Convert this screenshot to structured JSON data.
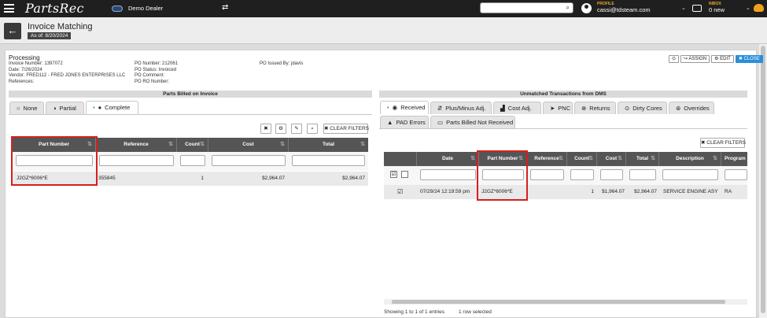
{
  "nav": {
    "logo": "PartsRec",
    "dealer": "Demo Dealer",
    "profile_label": "PROFILE",
    "profile_email": "cassi@tdsteam.com",
    "inbox_label": "INBOX",
    "inbox_count": "0 new"
  },
  "header": {
    "title": "Invoice Matching",
    "as_of": "As of: 8/20/2024"
  },
  "info": {
    "status": "Processing",
    "invoice_number": "Invoice Number: 1397072",
    "date": "Date: 7/26/2024",
    "vendor": "Vendor: FRED112 - FRED JONES ENTERPRISES LLC",
    "references": "References:",
    "po_number": "PO Number: 212061",
    "po_status": "PO Status: Invoiced",
    "po_comment": "PO Comment:",
    "po_ro_number": "PO RO Number:",
    "po_issued_by": "PO Issued By: jdavis"
  },
  "actions": {
    "assign": "ASSIGN",
    "edit": "EDIT",
    "close": "CLOSE"
  },
  "left": {
    "section_title": "Parts Billed on Invoice",
    "tabs": [
      "None",
      "Partial",
      "Complete"
    ],
    "clear_filters": "CLEAR FILTERS",
    "columns": [
      "Part Number",
      "Reference",
      "Count",
      "Cost",
      "Total"
    ],
    "rows": [
      {
        "part_number": "J2GZ*6006*E",
        "reference": "355845",
        "count": "1",
        "cost": "$2,964.07",
        "total": "$2,964.07"
      }
    ]
  },
  "right": {
    "section_title": "Unmatched Transactions from DMS",
    "tabs": [
      "Received",
      "Plus/Minus Adj.",
      "Cost Adj.",
      "PNC",
      "Returns",
      "Dirty Cores",
      "Overrides",
      "PAD Errors",
      "Parts Billed Not Received"
    ],
    "clear_filters": "CLEAR FILTERS",
    "columns": [
      "Date",
      "Part Number",
      "Reference",
      "Count",
      "Cost",
      "Total",
      "Description",
      "Program"
    ],
    "rows": [
      {
        "date": "07/29/24 12:19:59 pm",
        "part_number": "J2GZ*6006*E",
        "reference": "",
        "count": "1",
        "cost": "$1,964.07",
        "total": "$2,964.07",
        "description": "SERVICE ENGINE ASY",
        "program": "RA"
      }
    ],
    "footer_entries": "Showing 1 to 1 of 1 entries",
    "footer_selected": "1 row selected"
  },
  "colors": {
    "topbar": "#1f1f1f",
    "accent": "#e8a52a",
    "highlight": "#d61f1f",
    "primary_button": "#2a8ed8"
  }
}
